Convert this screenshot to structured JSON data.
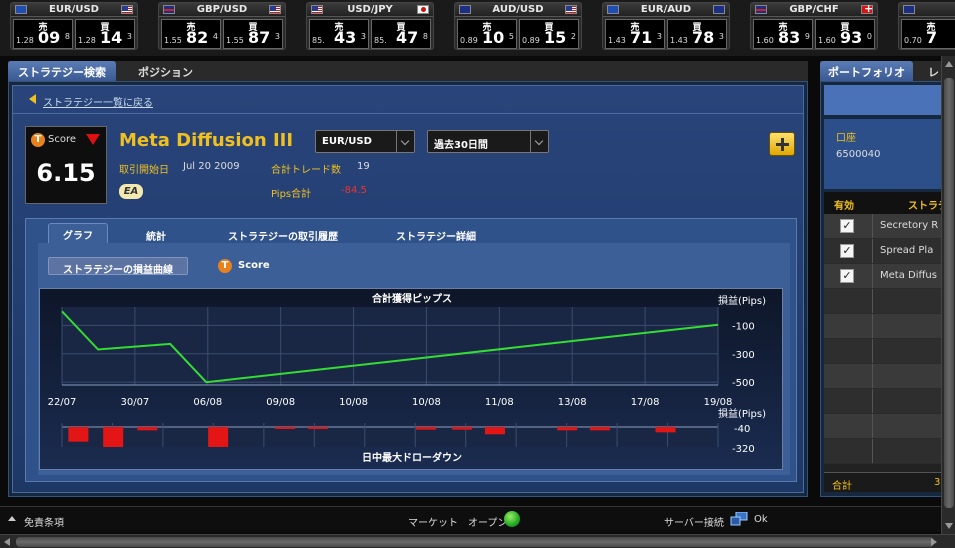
{
  "tickers": [
    {
      "pair": "EUR/USD",
      "flag_l": "eu",
      "flag_r": "us",
      "bid": {
        "pre": "1.28",
        "big": "09",
        "sup": "8"
      },
      "ask": {
        "pre": "1.28",
        "big": "14",
        "sup": "3"
      }
    },
    {
      "pair": "GBP/USD",
      "flag_l": "uk",
      "flag_r": "us",
      "bid": {
        "pre": "1.55",
        "big": "82",
        "sup": "4"
      },
      "ask": {
        "pre": "1.55",
        "big": "87",
        "sup": "3"
      }
    },
    {
      "pair": "USD/JPY",
      "flag_l": "us",
      "flag_r": "jp",
      "bid": {
        "pre": "85.",
        "big": "43",
        "sup": "3"
      },
      "ask": {
        "pre": "85.",
        "big": "47",
        "sup": "8"
      }
    },
    {
      "pair": "AUD/USD",
      "flag_l": "au",
      "flag_r": "us",
      "bid": {
        "pre": "0.89",
        "big": "10",
        "sup": "5"
      },
      "ask": {
        "pre": "0.89",
        "big": "15",
        "sup": "2"
      }
    },
    {
      "pair": "EUR/AUD",
      "flag_l": "eu",
      "flag_r": "au",
      "bid": {
        "pre": "1.43",
        "big": "71",
        "sup": "3"
      },
      "ask": {
        "pre": "1.43",
        "big": "78",
        "sup": "3"
      }
    },
    {
      "pair": "GBP/CHF",
      "flag_l": "uk",
      "flag_r": "ch",
      "bid": {
        "pre": "1.60",
        "big": "83",
        "sup": "9"
      },
      "ask": {
        "pre": "1.60",
        "big": "93",
        "sup": "0"
      }
    },
    {
      "pair": "",
      "flag_l": "au",
      "flag_r": "",
      "bid": {
        "pre": "0.70",
        "big": "7",
        "sup": ""
      },
      "ask": {
        "pre": "",
        "big": "",
        "sup": ""
      }
    }
  ],
  "labels": {
    "bid": "売",
    "ask": "買"
  },
  "main_tabs": [
    "ストラテジー検索",
    "ポジション"
  ],
  "back_link": "ストラテジー一覧に戻る",
  "score": {
    "label": "Score",
    "value": "6.15",
    "badge": "T"
  },
  "strategy": {
    "name": "Meta Diffusion III",
    "pair_select": "EUR/USD",
    "period_select": "過去30日間",
    "start_label": "取引開始日",
    "start_value": "Jul 20 2009",
    "trades_label": "合計トレード数",
    "trades_value": "19",
    "pips_label": "Pips合計",
    "pips_value": "-84.5",
    "ea": "EA"
  },
  "detail_tabs": [
    "グラフ",
    "統計",
    "ストラテジーの取引履歴",
    "ストラテジー詳細"
  ],
  "sub_button": "ストラテジーの損益曲線",
  "sub_score": "Score",
  "chart_data": {
    "type": "line",
    "title": "合計獲得ピップス",
    "ylabel": "損益(Pips)",
    "x_ticks": [
      "22/07",
      "30/07",
      "06/08",
      "09/08",
      "10/08",
      "10/08",
      "11/08",
      "13/08",
      "17/08",
      "19/08"
    ],
    "y_ticks": [
      -100,
      -300,
      -500
    ],
    "ylim": [
      -520,
      30
    ],
    "series": [
      {
        "name": "",
        "color": "#33dd33",
        "points": [
          [
            0,
            0
          ],
          [
            0.055,
            -270
          ],
          [
            0.165,
            -230
          ],
          [
            0.22,
            -500
          ],
          [
            1.0,
            -95
          ]
        ]
      }
    ],
    "drawdown": {
      "title": "日中最大ドローダウン",
      "ylabel": "損益(Pips)",
      "y_ticks": [
        -40,
        -320
      ],
      "bars": [
        {
          "x": 0.025,
          "value": -110
        },
        {
          "x": 0.078,
          "value": -150
        },
        {
          "x": 0.13,
          "value": -25
        },
        {
          "x": 0.238,
          "value": -150
        },
        {
          "x": 0.34,
          "value": -15
        },
        {
          "x": 0.39,
          "value": -15
        },
        {
          "x": 0.555,
          "value": -20
        },
        {
          "x": 0.61,
          "value": -20
        },
        {
          "x": 0.66,
          "value": -55
        },
        {
          "x": 0.77,
          "value": -25
        },
        {
          "x": 0.82,
          "value": -25
        },
        {
          "x": 0.92,
          "value": -40
        }
      ]
    }
  },
  "right": {
    "tabs": [
      "ポートフォリオ",
      "レ"
    ],
    "account_label": "口座",
    "account_value": "6500040",
    "col_enabled": "有効",
    "col_strategy": "ストラテ",
    "rows": [
      "Secretory R",
      "Spread Pla",
      "Meta Diffus"
    ],
    "footer": "合計",
    "footer_val": "3"
  },
  "status": {
    "disclaimer": "免責条項",
    "market": "マーケット　オープン",
    "server": "サーバー接続",
    "server_state": "Ok"
  }
}
